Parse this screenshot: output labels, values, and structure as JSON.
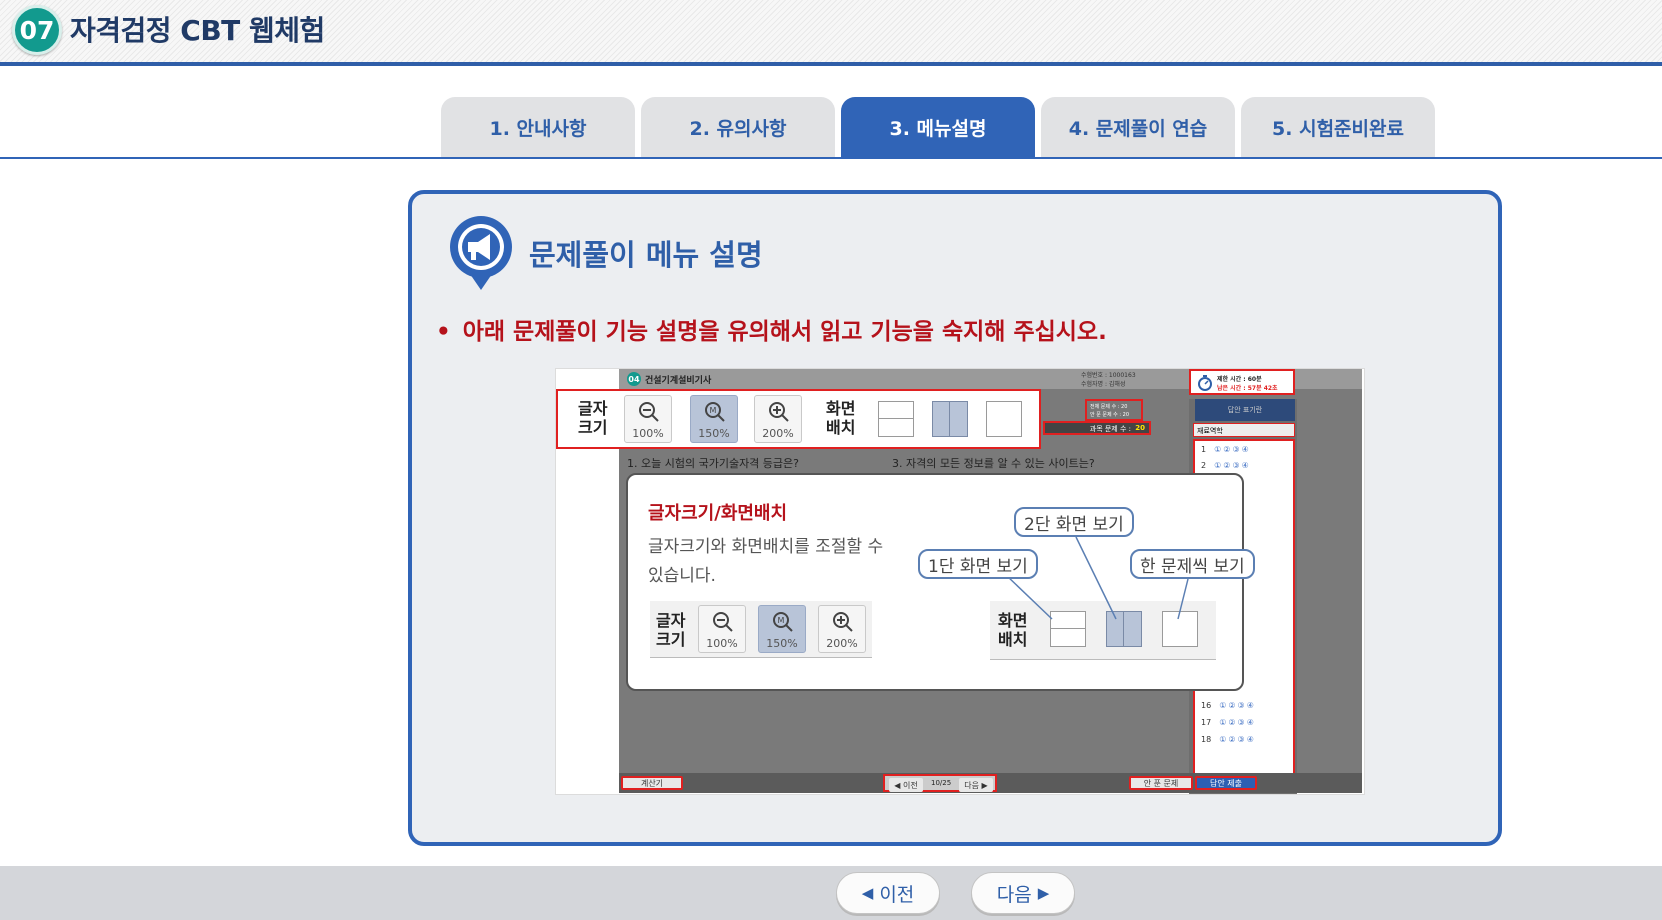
{
  "header": {
    "step_number": "07",
    "title": "자격검정 CBT 웹체험"
  },
  "tabs": [
    {
      "label": "1. 안내사항",
      "active": false
    },
    {
      "label": "2. 유의사항",
      "active": false
    },
    {
      "label": "3. 메뉴설명",
      "active": true
    },
    {
      "label": "4. 문제풀이 연습",
      "active": false
    },
    {
      "label": "5. 시험준비완료",
      "active": false
    }
  ],
  "panel": {
    "icon": "megaphone-icon",
    "title": "문제풀이 메뉴 설명",
    "notice_bullet": "•",
    "notice": "아래 문제풀이 기능 설명을 유의해서 읽고 기능을 숙지해 주십시오."
  },
  "screenshot": {
    "exam_badge": "04",
    "exam_name": "건설기계설비기사",
    "candidate_no": "수험번호 : 1000163",
    "candidate_name": "수험자명 : 김해성",
    "time_limit": "제한 시간 : 60분",
    "time_left": "남은 시간 : 57분 42초",
    "total_q": "전체 문제 수 : 20",
    "unsolved_q": "안 푼 문제 수 : 20",
    "subject_q_label": "과목 문제 수 :",
    "subject_q_value": "20",
    "answer_sheet": "답안 표기란",
    "subject_select": "재료역학",
    "question1": "1. 오늘 시험의 국가기술자격 등급은?",
    "question3": "3. 자격의 모든 정보를 알 수 있는 사이트는?",
    "answer_rows": [
      "1",
      "2",
      "16",
      "17",
      "18"
    ],
    "answer_circles": "①②③④",
    "calculator": "계산기",
    "prev": "◀ 이전",
    "page": "10/25",
    "next": "다음 ▶",
    "unsolved_btn": "안 푼 문제",
    "submit_btn": "답안 제출",
    "font_label": "글자\n크기",
    "zoom": [
      "100%",
      "150%",
      "200%"
    ],
    "layout_label": "화면\n배치"
  },
  "callout": {
    "title": "글자크기/화면배치",
    "description": "글자크기와 화면배치를 조절할 수 있습니다.",
    "bubble_two": "2단 화면 보기",
    "bubble_one": "1단 화면 보기",
    "bubble_single": "한 문제씩 보기",
    "font_label": "글자\n크기",
    "layout_label": "화면\n배치",
    "zoom": [
      "100%",
      "150%",
      "200%"
    ]
  },
  "footer": {
    "prev_label": "이전",
    "next_label": "다음",
    "prev_icon": "◀",
    "next_icon": "▶"
  }
}
